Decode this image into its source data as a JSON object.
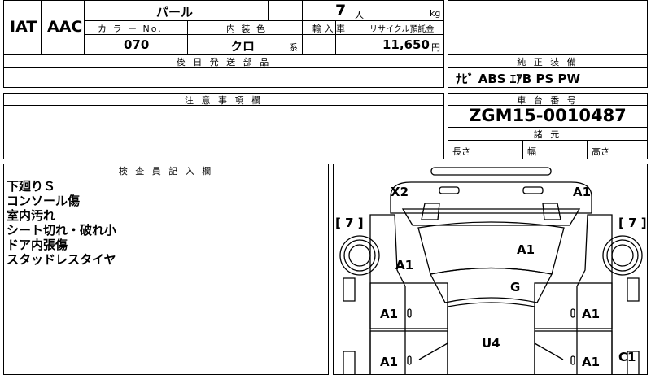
{
  "header": {
    "grade": "IAT",
    "code": "AAC",
    "color_name": "パール",
    "color_no_label": "カ ラ ー No.",
    "color_no": "070",
    "interior_label": "内 装 色",
    "interior_value": "クロ",
    "interior_suffix": "系",
    "capacity": "7",
    "capacity_unit": "人",
    "import_label": "輸 入 車",
    "weight_unit": "kg",
    "recycle_label": "リサイクル預託金",
    "recycle_value": "11,650",
    "recycle_unit": "円"
  },
  "parts_section": {
    "label": "後 日 発 送 部 品",
    "value": ""
  },
  "equipment": {
    "label": "純 正 装 備",
    "items": "ﾅﾋﾞ ABS ｴｱB PS PW"
  },
  "notes_section": {
    "label": "注 意 事 項 欄",
    "value": ""
  },
  "chassis": {
    "label": "車 台 番 号",
    "number": "ZGM15-0010487"
  },
  "specs": {
    "label": "諸 元",
    "length_label": "長さ",
    "width_label": "幅",
    "height_label": "高さ"
  },
  "inspector": {
    "label": "検 査 員 記 入 欄",
    "remarks": [
      "下廻りＳ",
      "コンソール傷",
      "室内汚れ",
      "シート切れ・破れ小",
      "ドア内張傷",
      "スタッドレスタイヤ"
    ]
  },
  "diagram": {
    "marks": {
      "front_left": "X2",
      "front_right": "A1",
      "hood": "A1",
      "left_fender": "A1",
      "windshield": "G",
      "left_front_door": "A1",
      "right_front_door": "A1",
      "roof": "U4",
      "left_rear_door": "A1",
      "right_rear_door": "A1",
      "right_quarter": "C1"
    },
    "tire_left": "[ 7 ]",
    "tire_right": "[ 7 ]"
  }
}
